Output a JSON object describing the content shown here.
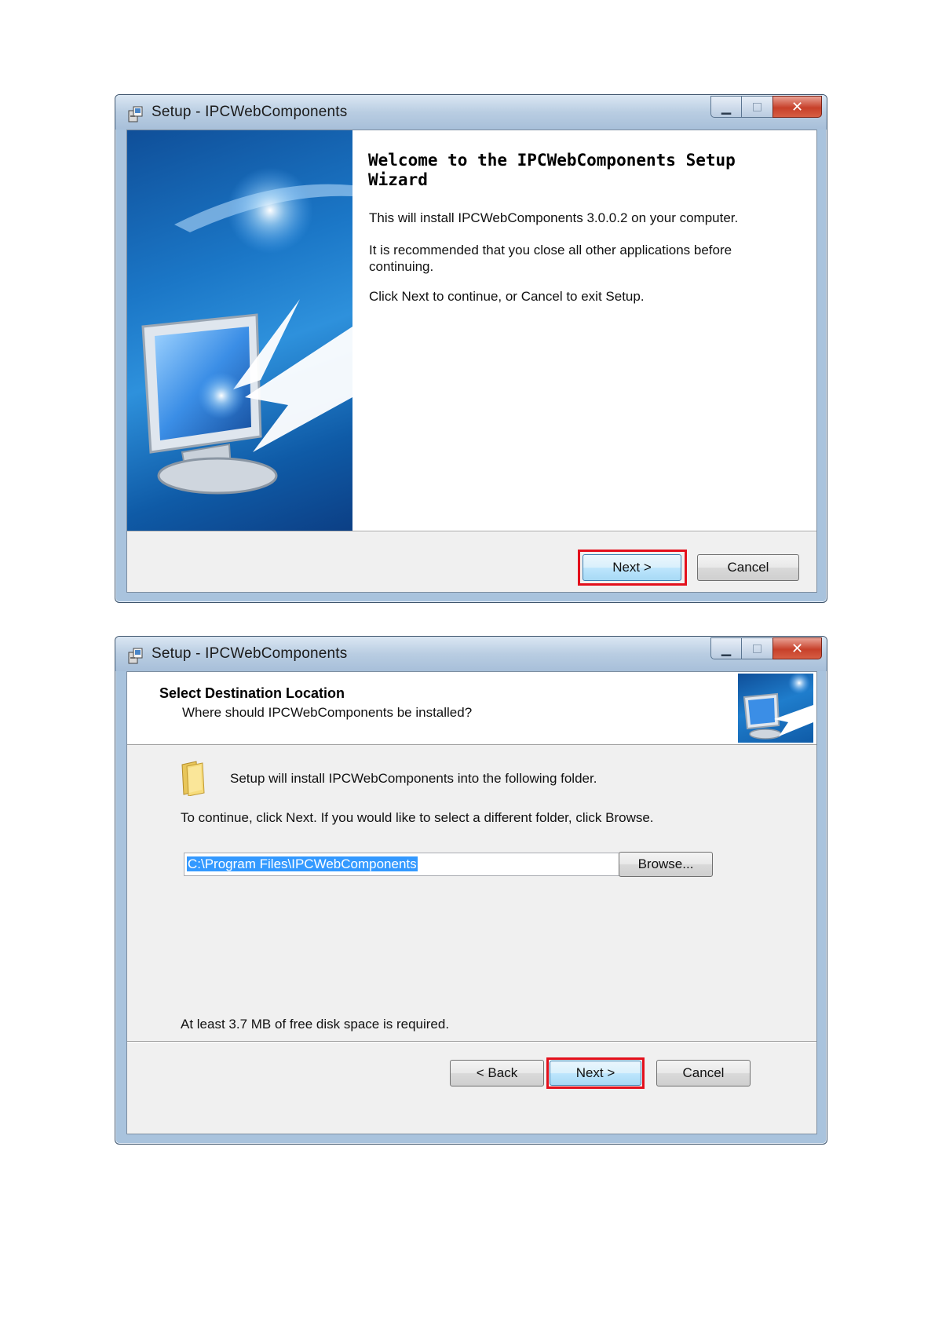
{
  "window1": {
    "title": "Setup - IPCWebComponents",
    "heading": "Welcome to the IPCWebComponents Setup Wizard",
    "para1": "This will install IPCWebComponents 3.0.0.2 on your computer.",
    "para2": "It is recommended that you close all other applications before continuing.",
    "para3": "Click Next to continue, or Cancel to exit Setup.",
    "next_label": "Next >",
    "cancel_label": "Cancel"
  },
  "window2": {
    "title": "Setup - IPCWebComponents",
    "header_title": "Select Destination Location",
    "header_subtitle": "Where should IPCWebComponents be installed?",
    "folder_text": "Setup will install IPCWebComponents into the following folder.",
    "continue_text": "To continue, click Next. If you would like to select a different folder, click Browse.",
    "path_value": "C:\\Program Files\\IPCWebComponents",
    "browse_label": "Browse...",
    "space_text": "At least 3.7 MB of free disk space is required.",
    "back_label": "< Back",
    "next_label": "Next >",
    "cancel_label": "Cancel"
  },
  "icons": [
    "setup-app-icon",
    "minimize-icon",
    "maximize-icon",
    "close-icon",
    "folder-icon",
    "computer-wizard-image"
  ],
  "colors": {
    "highlight": "#e3101c",
    "titlebar": "#b9cde2",
    "close_button": "#c7402a",
    "wizard_blue": "#1b77c7",
    "selection": "#3399ff"
  }
}
